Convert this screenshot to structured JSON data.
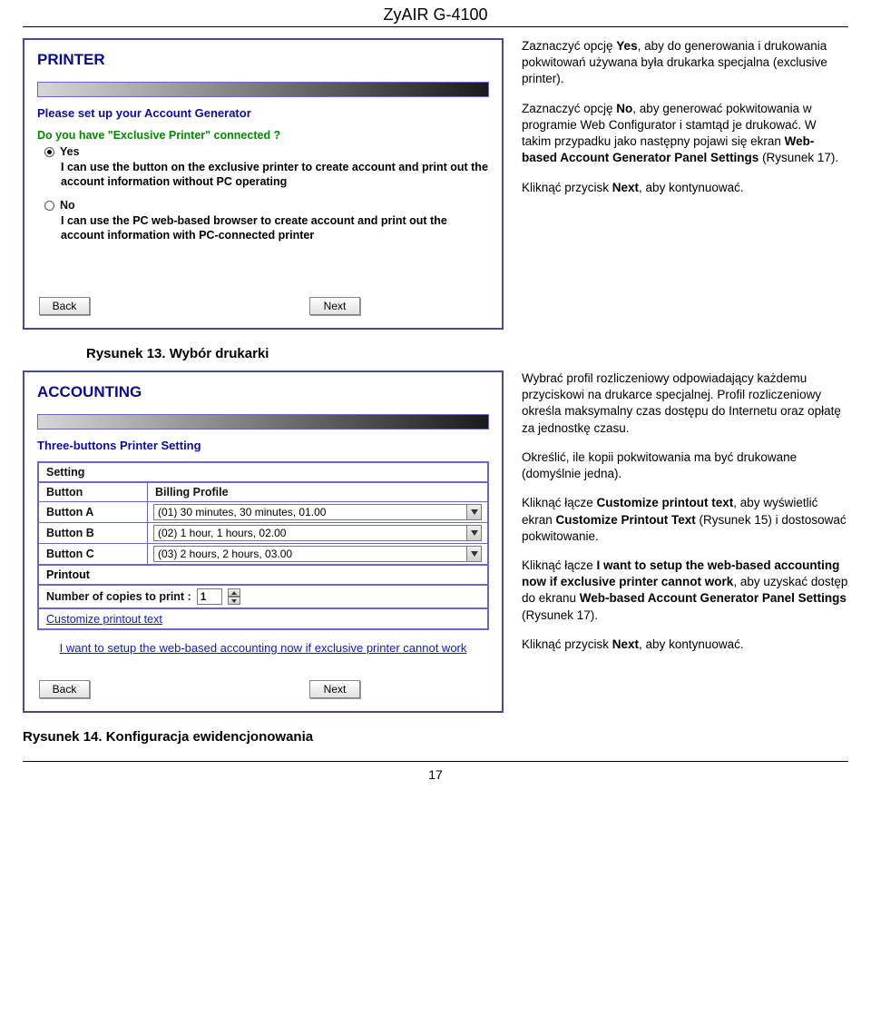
{
  "header": "ZyAIR G-4100",
  "printer": {
    "title": "PRINTER",
    "heading": "Please set up your Account Generator",
    "question": "Do you have \"Exclusive Printer\" connected ?",
    "yes": "Yes",
    "yes_desc": "I can use the button on the exclusive printer to create account and print out the account information without PC operating",
    "no": "No",
    "no_desc": "I can use the PC web-based browser to create account and print out the account information with PC-connected printer",
    "back": "Back",
    "next": "Next"
  },
  "right1": {
    "p1_a": "Zaznaczyć opcję ",
    "p1_b": "Yes",
    "p1_c": ", aby do generowania i drukowania pokwitowań używana była drukarka specjalna (exclusive printer).",
    "p2_a": "Zaznaczyć opcję ",
    "p2_b": "No",
    "p2_c": ", aby generować pokwitowania w programie Web Configurator i stamtąd je drukować. W takim przypadku jako następny pojawi się ekran ",
    "p2_d": "Web-based Account Generator Panel Settings",
    "p2_e": " (Rysunek 17).",
    "p3_a": "Kliknąć przycisk ",
    "p3_b": "Next",
    "p3_c": ", aby kontynuować."
  },
  "caption1": "Rysunek 13. Wybór drukarki",
  "accounting": {
    "title": "ACCOUNTING",
    "heading": "Three-buttons Printer Setting",
    "setting": "Setting",
    "col_button": "Button",
    "col_profile": "Billing Profile",
    "rows": [
      {
        "btn": "Button A",
        "val": "(01) 30 minutes, 30 minutes, 01.00"
      },
      {
        "btn": "Button B",
        "val": "(02) 1 hour, 1 hours, 02.00"
      },
      {
        "btn": "Button C",
        "val": "(03) 2 hours, 2 hours, 03.00"
      }
    ],
    "printout": "Printout",
    "copies_label": "Number of copies to print :",
    "copies_val": "1",
    "customize": "Customize printout text",
    "setup_link": "I want to setup the web-based accounting now if exclusive printer cannot work",
    "back": "Back",
    "next": "Next"
  },
  "right2": {
    "p1": "Wybrać profil rozliczeniowy odpowiadający każdemu przyciskowi na drukarce specjalnej. Profil rozliczeniowy określa maksymalny czas dostępu do Internetu oraz opłatę za jednostkę czasu.",
    "p2": "Określić, ile kopii pokwitowania ma być drukowane (domyślnie jedna).",
    "p3_a": "Kliknąć łącze ",
    "p3_b": "Customize printout text",
    "p3_c": ", aby wyświetlić ekran ",
    "p3_d": "Customize Printout Text",
    "p3_e": " (Rysunek 15) i dostosować pokwitowanie.",
    "p4_a": "Kliknąć łącze ",
    "p4_b": "I want to setup the web-based accounting now if exclusive printer cannot work",
    "p4_c": ", aby uzyskać dostęp do ekranu ",
    "p4_d": "Web-based Account Generator Panel Settings",
    "p4_e": " (Rysunek 17).",
    "p5_a": "Kliknąć przycisk ",
    "p5_b": "Next",
    "p5_c": ", aby kontynuować."
  },
  "caption2": "Rysunek 14. Konfiguracja ewidencjonowania",
  "page_number": "17"
}
